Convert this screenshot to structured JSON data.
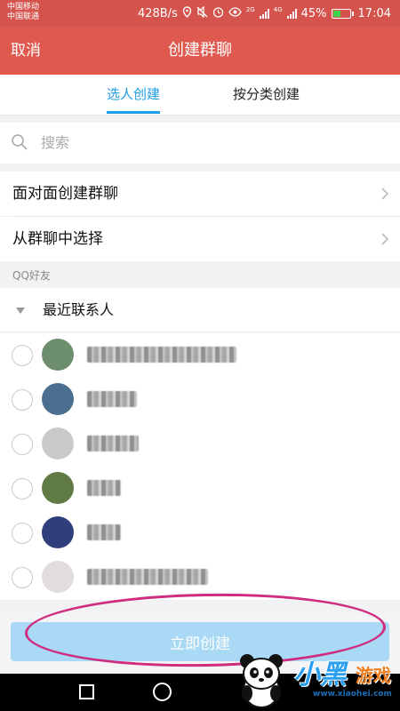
{
  "status_bar": {
    "carrier1": "中国移动",
    "carrier2": "中国联通",
    "speed": "428B/s",
    "net1": "2G",
    "net2": "4G",
    "battery": "45%",
    "battery_level": 0.45,
    "time": "17:04"
  },
  "title_bar": {
    "cancel": "取消",
    "title": "创建群聊"
  },
  "tabs": {
    "select_people": "选人创建",
    "by_category": "按分类创建"
  },
  "search": {
    "placeholder": "搜索"
  },
  "rows": {
    "face_to_face": "面对面创建群聊",
    "from_group": "从群聊中选择"
  },
  "section": {
    "qq_friends": "QQ好友"
  },
  "group": {
    "recent": "最近联系人"
  },
  "contacts": [
    {
      "avatar": "#6c8e6d"
    },
    {
      "avatar": "#4a6f8f"
    },
    {
      "avatar": "#c9c9c9"
    },
    {
      "avatar": "#5f7a44"
    },
    {
      "avatar": "#2e3f7c"
    },
    {
      "avatar": "#e3dcdc"
    }
  ],
  "bottom": {
    "create_button": "立即创建"
  },
  "watermark": {
    "brand": "小黑",
    "brand2": "游戏",
    "url": "www.xiaohei.com"
  },
  "colors": {
    "header": "#e0594f",
    "accent": "#1e9ee6",
    "button": "#a9d9f4",
    "annotation": "#cf2c7f"
  }
}
